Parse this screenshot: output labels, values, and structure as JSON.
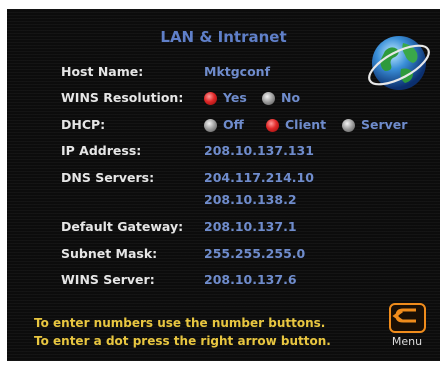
{
  "title": "LAN & Intranet",
  "fields": {
    "host_name": {
      "label": "Host Name:",
      "value": "Mktgconf"
    },
    "wins_resolution": {
      "label": "WINS Resolution:",
      "options": [
        "Yes",
        "No"
      ],
      "selected": "Yes"
    },
    "dhcp": {
      "label": "DHCP:",
      "options": [
        "Off",
        "Client",
        "Server"
      ],
      "selected": "Client"
    },
    "ip_address": {
      "label": "IP Address:",
      "value": "208.10.137.131"
    },
    "dns_servers": {
      "label": "DNS Servers:",
      "values": [
        "204.117.214.10",
        "208.10.138.2"
      ]
    },
    "default_gateway": {
      "label": "Default Gateway:",
      "value": "208.10.137.1"
    },
    "subnet_mask": {
      "label": "Subnet Mask:",
      "value": "255.255.255.0"
    },
    "wins_server": {
      "label": "WINS Server:",
      "value": "208.10.137.6"
    }
  },
  "hints": [
    "To enter numbers use the number buttons.",
    "To enter a dot press the right arrow button."
  ],
  "menu_label": "Menu",
  "colors": {
    "background": "#0c0c0c",
    "label": "#e6e6e6",
    "value": "#6f8ccc",
    "title": "#5f7fc8",
    "hint": "#e8c640",
    "selected_radio": "#e02828",
    "unselected_radio": "#9a9a9a",
    "menu_accent": "#f08c1c"
  },
  "icons": [
    "globe-icon",
    "back-arrow-icon"
  ]
}
